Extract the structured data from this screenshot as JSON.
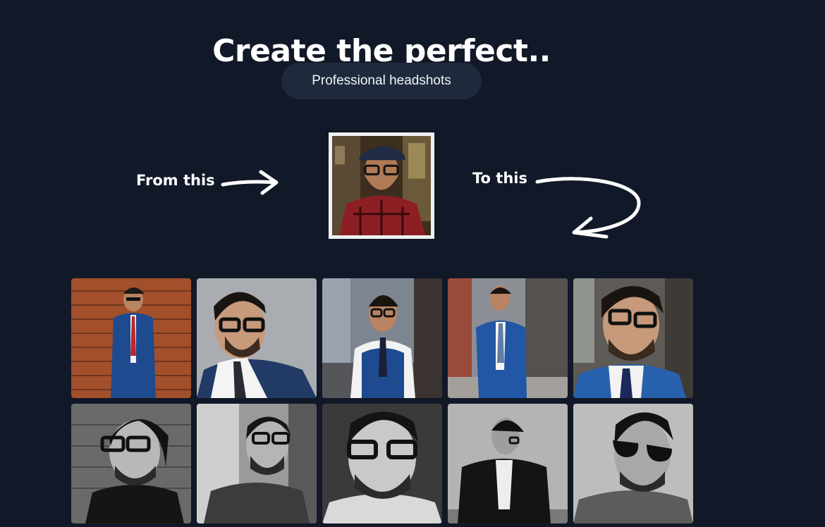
{
  "hero": {
    "title": "Create the perfect..",
    "category_pill": "Professional headshots"
  },
  "comparison": {
    "from_label": "From this",
    "to_label": "To this",
    "source_photo": {
      "subject": "selfie of man in cap, glasses and red plaid shirt",
      "icon": "person-photo"
    }
  },
  "gallery": {
    "items": [
      {
        "description": "blue suit, red tie, brick wall",
        "tone": "color"
      },
      {
        "description": "navy blazer, glasses, grey backdrop",
        "tone": "color"
      },
      {
        "description": "blue vest, white shirt, city street",
        "tone": "color"
      },
      {
        "description": "blue suit leaning on wall, street",
        "tone": "color"
      },
      {
        "description": "blue blazer close-up, smiling",
        "tone": "color"
      },
      {
        "description": "black t-shirt, glasses, brick wall",
        "tone": "bw"
      },
      {
        "description": "t-shirt, glasses, window light",
        "tone": "bw"
      },
      {
        "description": "close-up portrait, glasses",
        "tone": "bw"
      },
      {
        "description": "dark suit, looking down",
        "tone": "bw"
      },
      {
        "description": "sunglasses close-up",
        "tone": "bw"
      }
    ]
  },
  "colors": {
    "background": "#111827",
    "pill": "#1e293b",
    "text": "#ffffff"
  }
}
